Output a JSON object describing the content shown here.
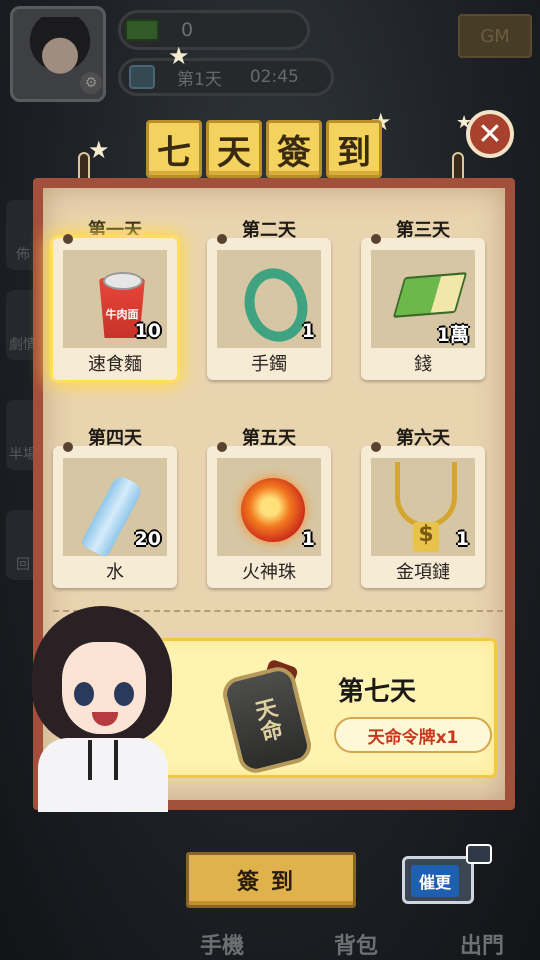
{
  "hud": {
    "money": "0",
    "day": "第1天",
    "time": "02:45",
    "gm_label": "GM",
    "side_tabs": [
      "佈",
      "劇情",
      "半場",
      "回"
    ]
  },
  "title_chars": [
    "七",
    "天",
    "簽",
    "到"
  ],
  "close_icon": "✕",
  "days": [
    {
      "label": "第一天",
      "item": "速食麵",
      "qty": "10",
      "icon": "instant-noodle-icon",
      "active": true
    },
    {
      "label": "第二天",
      "item": "手鐲",
      "qty": "1",
      "icon": "bangle-icon",
      "active": false
    },
    {
      "label": "第三天",
      "item": "錢",
      "qty": "1萬",
      "icon": "cash-icon",
      "active": false
    },
    {
      "label": "第四天",
      "item": "水",
      "qty": "20",
      "icon": "water-bottle-icon",
      "active": false
    },
    {
      "label": "第五天",
      "item": "火神珠",
      "qty": "1",
      "icon": "fire-orb-icon",
      "active": false
    },
    {
      "label": "第六天",
      "item": "金項鏈",
      "qty": "1",
      "icon": "gold-chain-icon",
      "active": false
    }
  ],
  "noodle_cup_text": "牛肉面",
  "day7": {
    "label": "第七天",
    "reward": "天命令牌x1",
    "token_text": "天命"
  },
  "signin_button": "簽到",
  "tv_label": "催更",
  "bottom_nav": [
    "手機",
    "背包",
    "出門"
  ],
  "colors": {
    "board_border": "#a24f3b",
    "title_tile": "#f3d25d",
    "active_glow": "#ffd84a",
    "reward_red": "#c8381e"
  }
}
